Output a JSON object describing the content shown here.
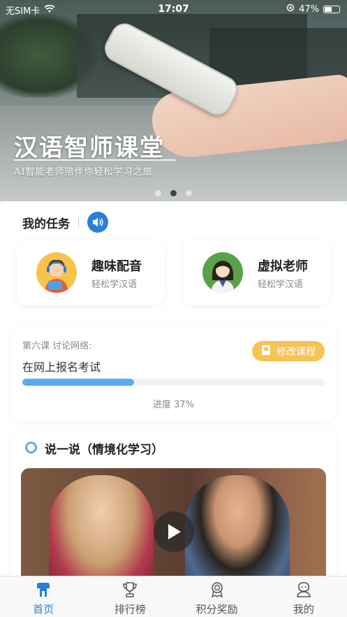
{
  "status_bar": {
    "carrier": "无SIM卡",
    "time": "17:07",
    "battery": "47%",
    "battery_level": 0.47
  },
  "banner": {
    "title": "汉语智师课堂",
    "subtitle": "AI智能老师陪伴你轻松学习之旅",
    "slide_count": 3,
    "active_slide": 1
  },
  "tasks": {
    "header": "我的任务",
    "speaker_icon": "speaker-icon",
    "items": [
      {
        "title": "趣味配音",
        "subtitle": "轻松学汉语",
        "avatar": "dubbing-girl-avatar"
      },
      {
        "title": "虚拟老师",
        "subtitle": "轻松学汉语",
        "avatar": "virtual-teacher-avatar"
      }
    ]
  },
  "lesson": {
    "label": "第六课 讨论网络:",
    "name": "在网上报名考试",
    "modify_label": "修改课程",
    "progress_percent": 37,
    "progress_text": "进度 37%"
  },
  "speak": {
    "title": "说一说（情境化学习）",
    "video_icon": "play-icon"
  },
  "tabbar": {
    "items": [
      {
        "label": "首页",
        "icon": "home-icon",
        "active": true
      },
      {
        "label": "排行榜",
        "icon": "trophy-icon",
        "active": false
      },
      {
        "label": "积分奖励",
        "icon": "medal-icon",
        "active": false
      },
      {
        "label": "我的",
        "icon": "profile-icon",
        "active": false
      }
    ]
  },
  "colors": {
    "accent": "#2b7fd9",
    "progress": "#5aaaf0",
    "modify_button": "#f8c355"
  }
}
